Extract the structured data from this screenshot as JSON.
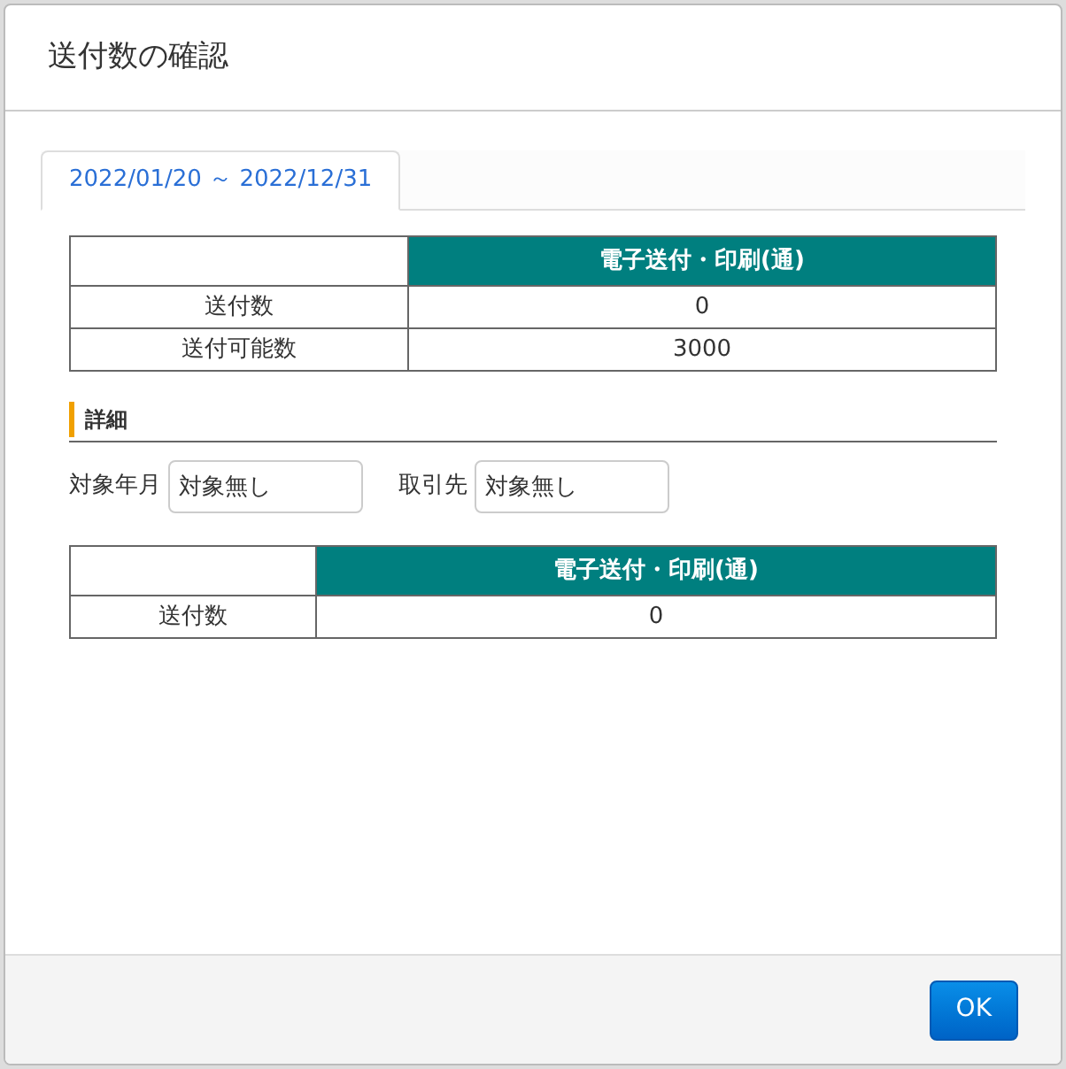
{
  "dialog": {
    "title": "送付数の確認"
  },
  "tabs": [
    {
      "label": "2022/01/20 ～ 2022/12/31",
      "selected": true
    }
  ],
  "summary_table": {
    "columns": [
      "電子送付・印刷(通)"
    ],
    "rows": [
      {
        "label": "送付数",
        "values": [
          "0"
        ]
      },
      {
        "label": "送付可能数",
        "values": [
          "3000"
        ]
      }
    ]
  },
  "details": {
    "heading": "詳細",
    "filters": [
      {
        "label": "対象年月",
        "value": "対象無し"
      },
      {
        "label": "取引先",
        "value": "対象無し"
      }
    ],
    "table": {
      "columns": [
        "電子送付・印刷(通)"
      ],
      "rows": [
        {
          "label": "送付数",
          "values": [
            "0"
          ]
        }
      ]
    }
  },
  "buttons": [
    {
      "label": "OK",
      "kind": "primary"
    }
  ]
}
